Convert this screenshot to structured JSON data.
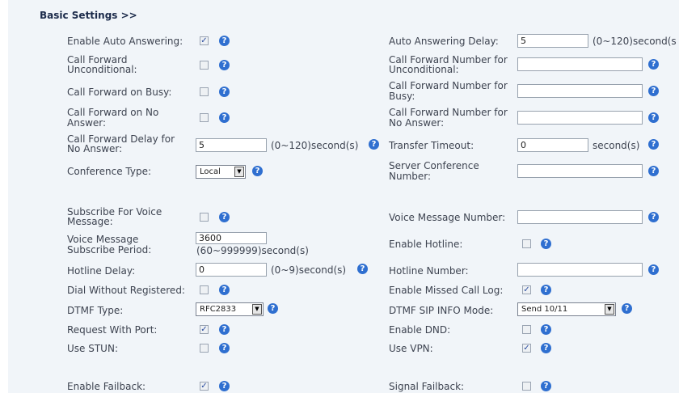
{
  "section_title": "Basic Settings >>",
  "help_glyph": "?",
  "check_glyph": "✓",
  "select_arrow_glyph": "▼",
  "left": {
    "auto_answer": {
      "label": "Enable Auto Answering:",
      "checked": true
    },
    "cfu": {
      "label1": "Call Forward",
      "label2": "Unconditional:",
      "checked": false
    },
    "cfb": {
      "label": "Call Forward on Busy:",
      "checked": false
    },
    "cfna": {
      "label1": "Call Forward on No",
      "label2": "Answer:",
      "checked": false
    },
    "cf_delay": {
      "label1": "Call Forward Delay for",
      "label2": "No Answer:",
      "value": "5",
      "unit": "(0~120)second(s)"
    },
    "conference_type": {
      "label": "Conference Type:",
      "value": "Local"
    },
    "subscribe_vm": {
      "label1": "Subscribe For Voice",
      "label2": "Message:",
      "checked": false
    },
    "vm_period": {
      "label1": "Voice Message",
      "label2": "Subscribe Period:",
      "value": "3600",
      "unit": "(60~999999)second(s)"
    },
    "hotline_delay": {
      "label": "Hotline Delay:",
      "value": "0",
      "unit": "(0~9)second(s)"
    },
    "dial_unreg": {
      "label": "Dial Without Registered:",
      "checked": false
    },
    "dtmf_type": {
      "label": "DTMF Type:",
      "value": "RFC2833"
    },
    "request_port": {
      "label": "Request With Port:",
      "checked": true
    },
    "use_stun": {
      "label": "Use STUN:",
      "checked": false
    },
    "enable_failback": {
      "label": "Enable Failback:",
      "checked": true
    }
  },
  "right": {
    "aa_delay": {
      "label": "Auto Answering Delay:",
      "value": "5",
      "unit": "(0~120)second(s"
    },
    "cfu_number": {
      "label1": "Call Forward Number for",
      "label2": "Unconditional:",
      "value": ""
    },
    "cfb_number": {
      "label1": "Call Forward Number for",
      "label2": "Busy:",
      "value": ""
    },
    "cfna_number": {
      "label1": "Call Forward Number for",
      "label2": "No Answer:",
      "value": ""
    },
    "transfer_timeout": {
      "label": "Transfer Timeout:",
      "value": "0",
      "unit": "second(s)"
    },
    "server_conf": {
      "label1": "Server Conference",
      "label2": "Number:",
      "value": ""
    },
    "vm_number": {
      "label": "Voice Message Number:",
      "value": ""
    },
    "hotline": {
      "label": "Enable Hotline:",
      "checked": false
    },
    "hotline_number": {
      "label": "Hotline Number:",
      "value": ""
    },
    "missed_call": {
      "label": "Enable Missed Call Log:",
      "checked": true
    },
    "dtmf_sip_info": {
      "label": "DTMF SIP INFO Mode:",
      "value": "Send 10/11"
    },
    "dnd": {
      "label": "Enable DND:",
      "checked": false
    },
    "vpn": {
      "label": "Use VPN:",
      "checked": true
    },
    "signal_failback": {
      "label": "Signal Failback:",
      "checked": false
    }
  }
}
